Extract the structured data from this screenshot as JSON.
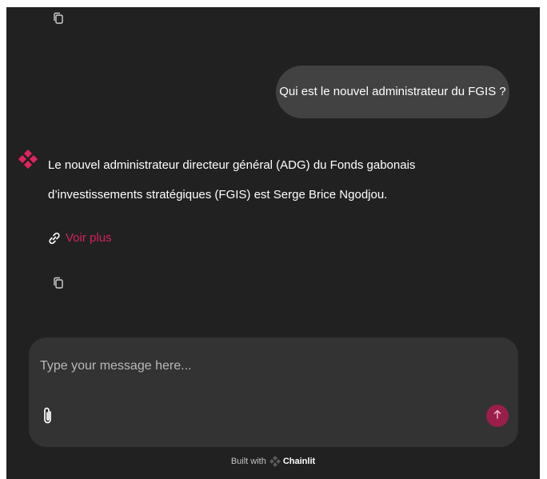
{
  "messages": {
    "user_question": "Qui est le nouvel administrateur du FGIS ?",
    "assistant_answer": "Le nouvel administrateur directeur général (ADG) du Fonds gabonais d’investissements stratégiques (FGIS) est Serge Brice Ngodjou.",
    "voir_plus_label": "Voir plus"
  },
  "composer": {
    "placeholder": "Type your message here..."
  },
  "footer": {
    "built_with": "Built with",
    "brand": "Chainlit"
  },
  "icons": {
    "copy": "copy-icon",
    "link": "link-icon",
    "attach": "paperclip-icon",
    "send": "arrow-up-icon",
    "avatar": "chainlit-logo-icon"
  },
  "colors": {
    "background": "#212121",
    "bubble": "#424242",
    "composer": "#333333",
    "accent": "#d3225f",
    "send_button": "#9a1e4a"
  }
}
